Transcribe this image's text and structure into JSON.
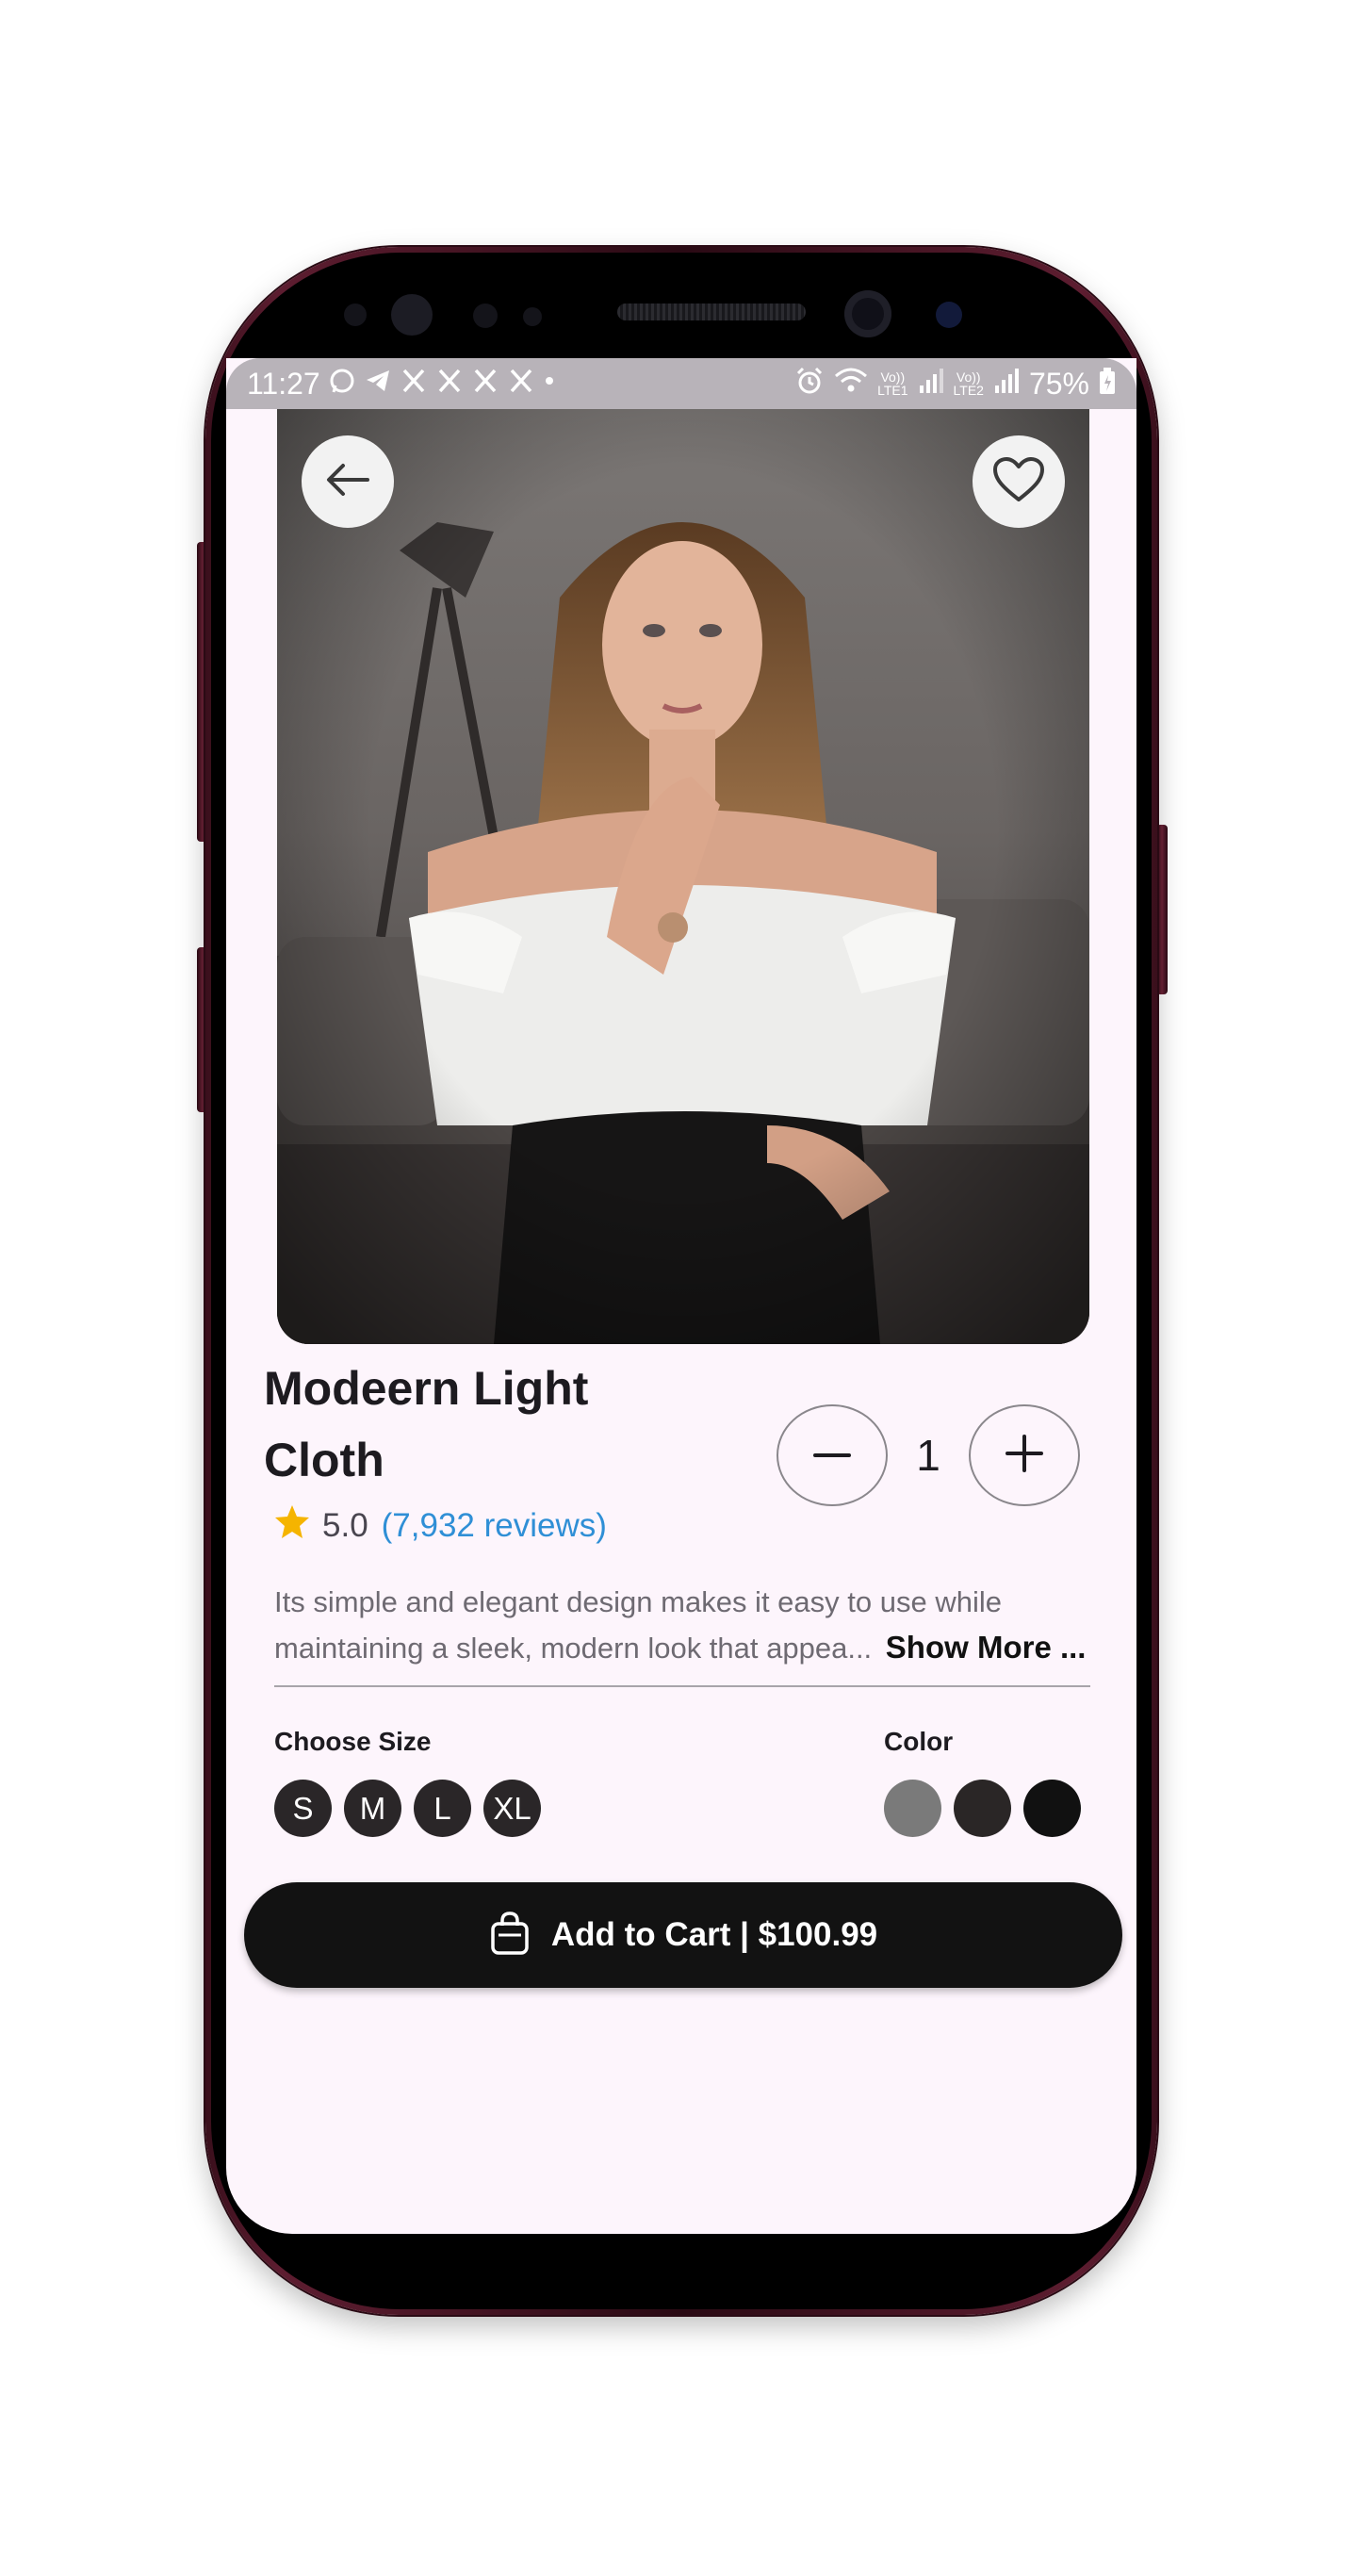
{
  "status_bar": {
    "time": "11:27",
    "battery": "75%",
    "sim1_label": "LTE1",
    "sim2_label": "LTE2",
    "volte": "Vo))"
  },
  "header": {
    "back_icon": "arrow-left-icon",
    "favorite_icon": "heart-outline-icon"
  },
  "product": {
    "title_line1": "Modeern Light",
    "title_line2": "Cloth",
    "rating": "5.0",
    "reviews": "(7,932 reviews)",
    "description": "Its simple and elegant design makes it easy to use while maintaining a sleek, modern look that appea...",
    "show_more": "Show More ..."
  },
  "quantity": {
    "value": "1",
    "decrement_icon": "minus-icon",
    "increment_icon": "plus-icon"
  },
  "size": {
    "label": "Choose Size",
    "options": [
      "S",
      "M",
      "L",
      "XL"
    ]
  },
  "color": {
    "label": "Color",
    "swatches": [
      "#7a7a7a",
      "#2a2626",
      "#111111"
    ]
  },
  "cart": {
    "label": "Add to Cart | $100.99",
    "icon": "shopping-bag-icon"
  },
  "theme": {
    "screen_bg": "#fdf5fc",
    "accent_link": "#2f8fd6",
    "star": "#f5b400"
  }
}
